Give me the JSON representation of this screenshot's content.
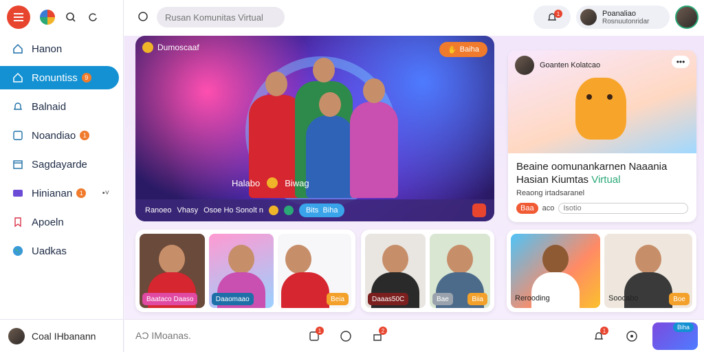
{
  "app": {
    "search_placeholder": "Rusan Komunitas Virtual",
    "compose_placeholder": "AƆ IMoanas."
  },
  "sidebar": {
    "items": [
      {
        "label": "Hanon",
        "icon": "home-icon",
        "active": false
      },
      {
        "label": "Ronuntiss",
        "icon": "community-icon",
        "active": true,
        "badge": "9"
      },
      {
        "label": "Balnaid",
        "icon": "bell-icon",
        "active": false
      },
      {
        "label": "Noandiao",
        "icon": "messages-icon",
        "active": false,
        "badge": "1"
      },
      {
        "label": "Sagdayarde",
        "icon": "calendar-icon",
        "active": false
      },
      {
        "label": "Hinianan",
        "icon": "video-icon",
        "active": false,
        "badge": "1",
        "has_chevron": true
      },
      {
        "label": "Apoeln",
        "icon": "bookmark-icon",
        "active": false
      },
      {
        "label": "Uadkas",
        "icon": "globe-icon",
        "active": false
      }
    ],
    "user_name": "Coal IHbanann"
  },
  "header": {
    "notif_badge": "1",
    "profile_name": "Poanaliao",
    "profile_sub": "Rosnuutonridar"
  },
  "hero": {
    "tag": "Dumoscaaf",
    "action_label": "Baiha",
    "caption_left": "Halabo",
    "caption_right": "Biwag",
    "bar_left": "Ranoeo",
    "bar_live": "Vhasy",
    "bar_middle": "Osoe Ho Sonolt n",
    "bar_chip_left": "Bits",
    "bar_chip_right": "Biha"
  },
  "right_card": {
    "header_title": "Goanten Kolatcao",
    "title_line1": "Beaine oomunankarnen Naaania",
    "title_line2": "Hasian Kiumtas",
    "title_line2_accent": "Virtual",
    "subtitle": "Reaong irtadsaranel",
    "chip_label": "Baa",
    "input_prefix": "aco",
    "input_placeholder": "Isotio"
  },
  "bottom_cards": [
    {
      "tiles": [
        {
          "label": "Baataco Daaso",
          "label_color": "#e04aa3"
        },
        {
          "label": "Daaomaao",
          "label_color": "#1d6fa8"
        },
        {
          "button": "Beia"
        }
      ]
    },
    {
      "tiles": [
        {
          "label": "Daaas50C",
          "label_color": "#7b1f1f"
        },
        {
          "label": "Bae",
          "button": "Biia",
          "label_color": "#9aa3ad"
        }
      ]
    },
    {
      "tiles": [
        {
          "text": "Rerooding"
        },
        {
          "text": "Soocabo",
          "button": "Boe"
        }
      ]
    }
  ],
  "footer": {
    "badge_1": "1",
    "badge_2": "2",
    "badge_3": "1",
    "thumb_badge": "Biha"
  },
  "colors": {
    "accent": "#1391d3",
    "brand_red": "#e8452f",
    "orange": "#f07b2c",
    "green": "#2aa876"
  }
}
